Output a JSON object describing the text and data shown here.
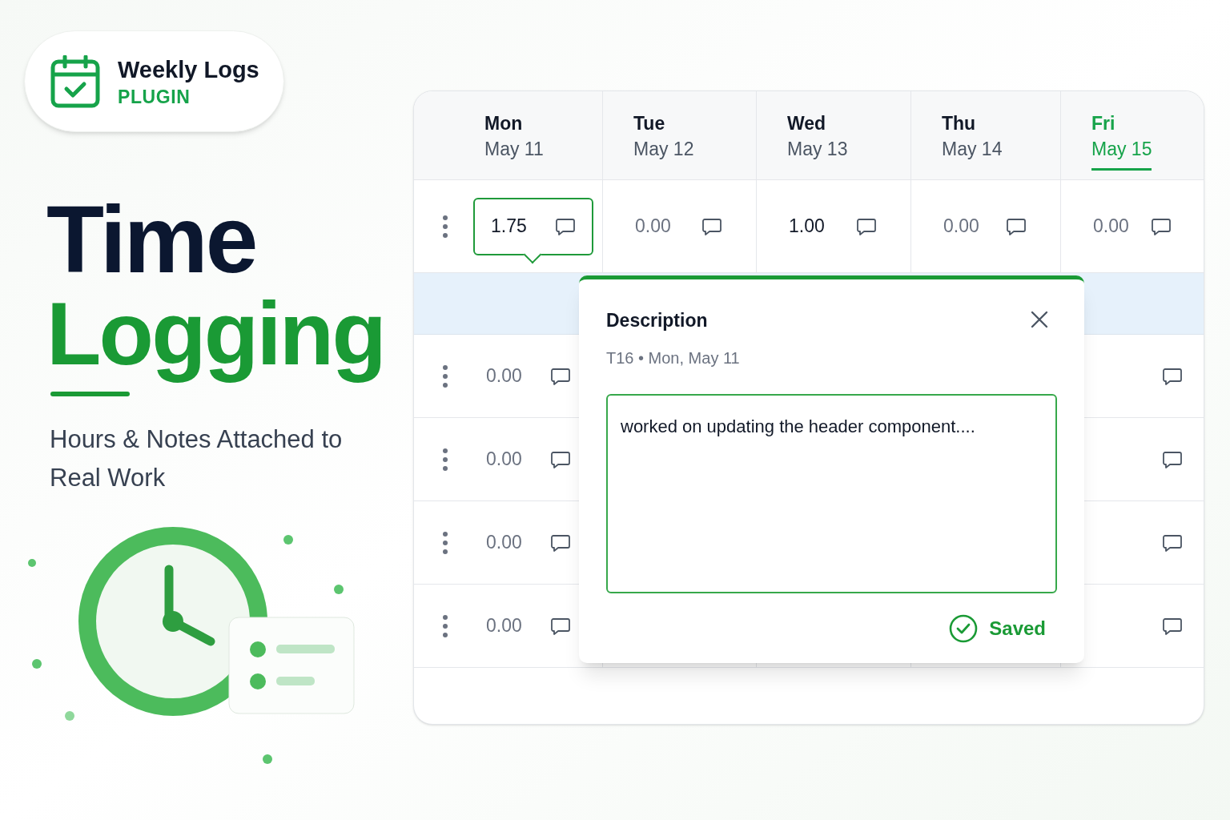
{
  "brand": {
    "title": "Weekly Logs",
    "subtitle": "PLUGIN"
  },
  "headline": [
    "Time",
    "Logging"
  ],
  "tagline": "Hours & Notes Attached to Real Work",
  "table": {
    "days": [
      {
        "day": "Mon",
        "date": "May 11",
        "selected": false
      },
      {
        "day": "Tue",
        "date": "May 12",
        "selected": false
      },
      {
        "day": "Wed",
        "date": "May 13",
        "selected": false
      },
      {
        "day": "Thu",
        "date": "May 14",
        "selected": false
      },
      {
        "day": "Fri",
        "date": "May 15",
        "selected": true
      }
    ],
    "rows": [
      {
        "highlighted": false,
        "cells": [
          {
            "value": "1.75",
            "logged": true,
            "selected": true
          },
          {
            "value": "0.00",
            "logged": false,
            "selected": false
          },
          {
            "value": "1.00",
            "logged": true,
            "selected": false
          },
          {
            "value": "0.00",
            "logged": false,
            "selected": false
          },
          {
            "value": "0.00",
            "logged": false,
            "selected": false
          }
        ]
      },
      {
        "highlighted": true,
        "cells": []
      },
      {
        "highlighted": false,
        "cells": [
          {
            "value": "0.00",
            "logged": false,
            "selected": false
          }
        ]
      },
      {
        "highlighted": false,
        "cells": [
          {
            "value": "0.00",
            "logged": false,
            "selected": false
          }
        ]
      },
      {
        "highlighted": false,
        "cells": [
          {
            "value": "0.00",
            "logged": false,
            "selected": false
          }
        ]
      },
      {
        "highlighted": false,
        "cells": [
          {
            "value": "0.00",
            "logged": false,
            "selected": false
          }
        ]
      }
    ]
  },
  "popover": {
    "title": "Description",
    "subtitle": "T16 • Mon, May 11",
    "value": "worked on updating the header component....",
    "status": "Saved"
  }
}
